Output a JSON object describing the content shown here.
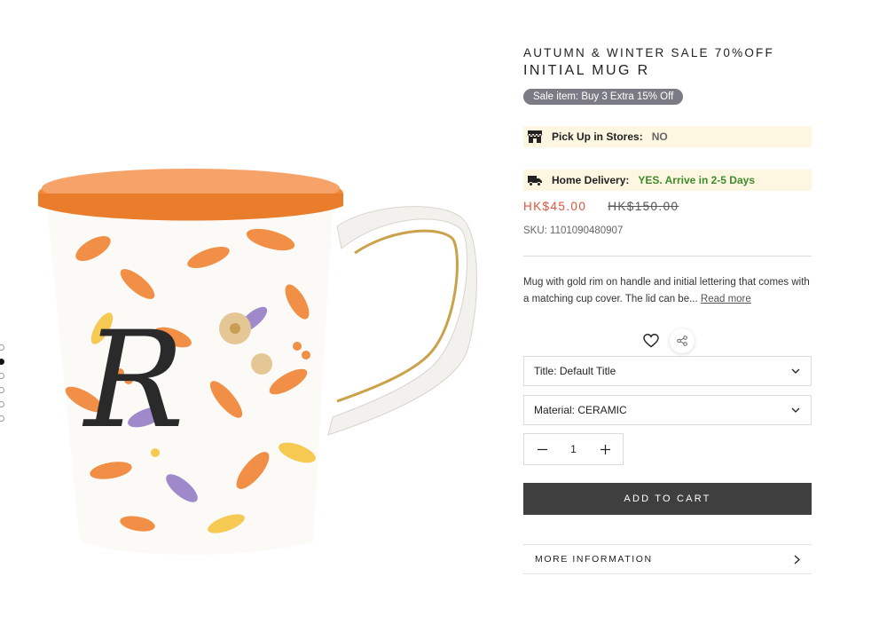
{
  "gallery": {
    "slides": 6,
    "active_index": 1
  },
  "product": {
    "sale_title": "AUTUMN & WINTER SALE 70%OFF",
    "title": "INITIAL MUG R",
    "badge": "Sale item: Buy 3 Extra 15% Off",
    "pickup": {
      "label": "Pick Up in Stores:",
      "value": "NO",
      "icon": "store-icon"
    },
    "delivery": {
      "label": "Home Delivery:",
      "value": "YES. Arrive in 2-5 Days",
      "icon": "truck-icon"
    },
    "price_sale": "HK$45.00",
    "price_compare": "HK$150.00",
    "sku_label": "SKU:",
    "sku": "1101090480907",
    "description": "Mug with gold rim on handle and initial lettering that comes with a matching cup cover. The lid can be...",
    "read_more": "Read more",
    "options": {
      "title": "Title: Default Title",
      "material": "Material: CERAMIC"
    },
    "quantity": "1",
    "add_to_cart": "ADD TO CART",
    "more_info": "MORE INFORMATION"
  },
  "colors": {
    "accent_price": "#e0523c",
    "available_green": "#3e8b2a",
    "badge_bg": "#7b7b85",
    "notice_bg": "#fdf7e2",
    "cart_bg": "#3f3f3f"
  }
}
